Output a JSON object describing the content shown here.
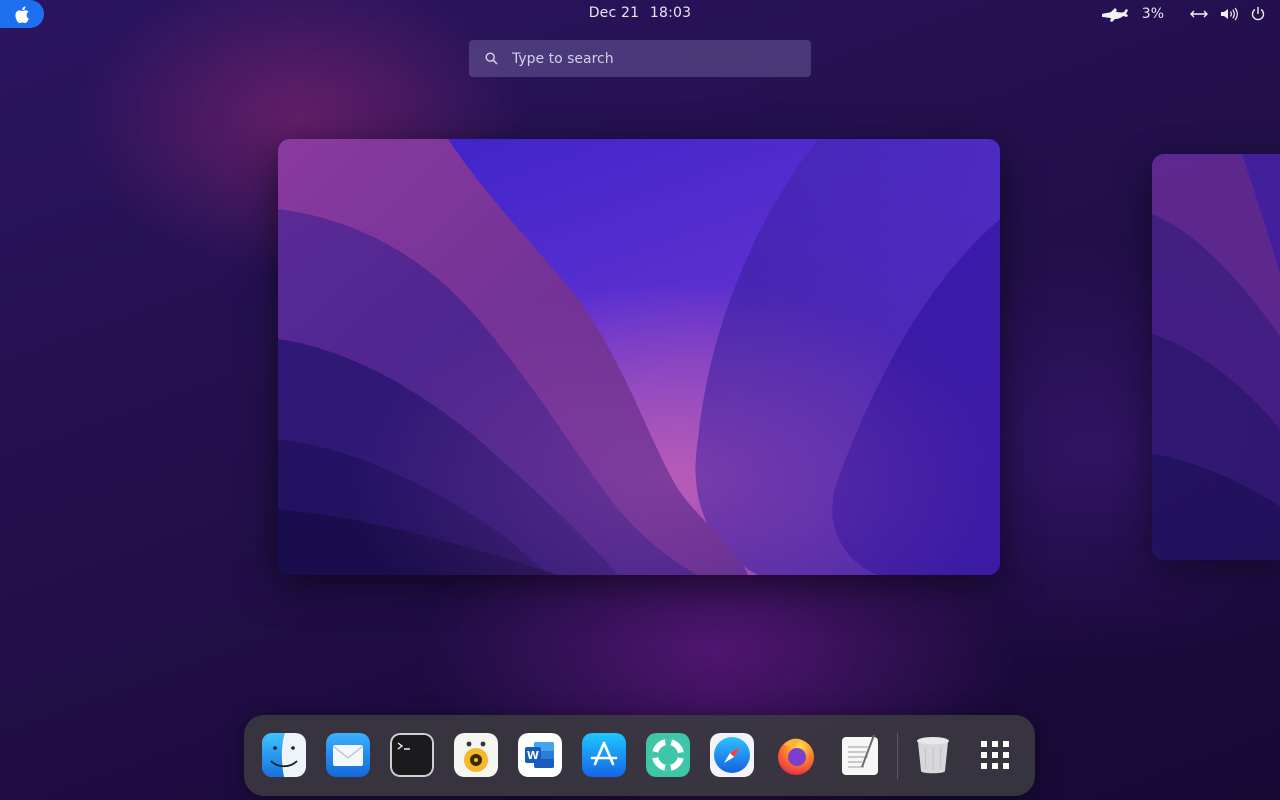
{
  "topbar": {
    "date": "Dec 21",
    "time": "18:03",
    "battery_percent": "3%",
    "icons": [
      "apple-logo-icon",
      "battery-status-icon",
      "network-icon",
      "volume-icon",
      "power-icon"
    ],
    "accent": "#1e6ff0"
  },
  "search": {
    "placeholder": "Type to search"
  },
  "workspaces": [
    {
      "name": "workspace-1",
      "active": true
    },
    {
      "name": "workspace-2",
      "active": false
    }
  ],
  "dock": {
    "apps": [
      {
        "name": "Finder",
        "icon": "finder-icon"
      },
      {
        "name": "Mail",
        "icon": "mail-icon"
      },
      {
        "name": "Terminal",
        "icon": "terminal-icon"
      },
      {
        "name": "Rhythmbox",
        "icon": "rhythmbox-icon"
      },
      {
        "name": "Word",
        "icon": "word-icon"
      },
      {
        "name": "App Store",
        "icon": "app-store-icon"
      },
      {
        "name": "Help",
        "icon": "help-lifebuoy-icon"
      },
      {
        "name": "Safari",
        "icon": "safari-compass-icon"
      },
      {
        "name": "Firefox",
        "icon": "firefox-icon"
      },
      {
        "name": "TextEdit",
        "icon": "text-editor-icon"
      },
      {
        "name": "Trash",
        "icon": "trash-icon"
      },
      {
        "name": "Show Applications",
        "icon": "app-grid-icon"
      }
    ]
  }
}
